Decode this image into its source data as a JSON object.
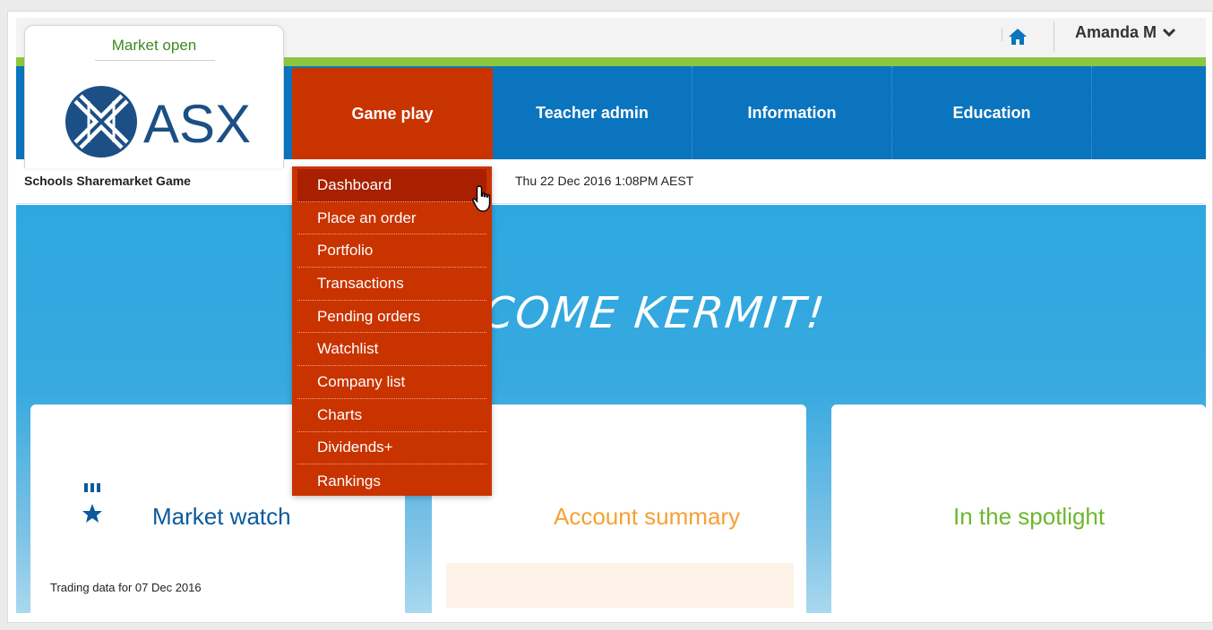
{
  "header": {
    "market_status": "Market open",
    "user_name": "Amanda M",
    "logo_text": "ASX"
  },
  "nav": {
    "items": [
      {
        "label": "Game play",
        "active": true
      },
      {
        "label": "Teacher admin",
        "active": false
      },
      {
        "label": "Information",
        "active": false
      },
      {
        "label": "Education",
        "active": false
      }
    ]
  },
  "subheader": {
    "site_name": "Schools Sharemarket Game",
    "datetime": "Thu 22 Dec 2016 1:08PM AEST"
  },
  "dropdown": {
    "items": [
      {
        "label": "Dashboard",
        "hover": true
      },
      {
        "label": "Place an order"
      },
      {
        "label": "Portfolio"
      },
      {
        "label": "Transactions"
      },
      {
        "label": "Pending orders"
      },
      {
        "label": "Watchlist"
      },
      {
        "label": "Company list"
      },
      {
        "label": "Charts"
      },
      {
        "label": "Dividends+"
      },
      {
        "label": "Rankings"
      }
    ]
  },
  "hero": {
    "welcome_text": "COME KERMIT!"
  },
  "cards": [
    {
      "title": "Market watch",
      "icon": "medal-icon",
      "color": "#0a5a9c",
      "note": "Trading data for 07 Dec 2016"
    },
    {
      "title": "Account summary",
      "icon": "clipboard-icon",
      "color": "#f7a033"
    },
    {
      "title": "In the spotlight",
      "icon": "lightning-icon",
      "color": "#6cb82c"
    }
  ],
  "colors": {
    "nav_blue": "#0a74be",
    "nav_active": "#c93300",
    "green_stripe": "#8dc63f",
    "status_green": "#3c8a1e"
  }
}
